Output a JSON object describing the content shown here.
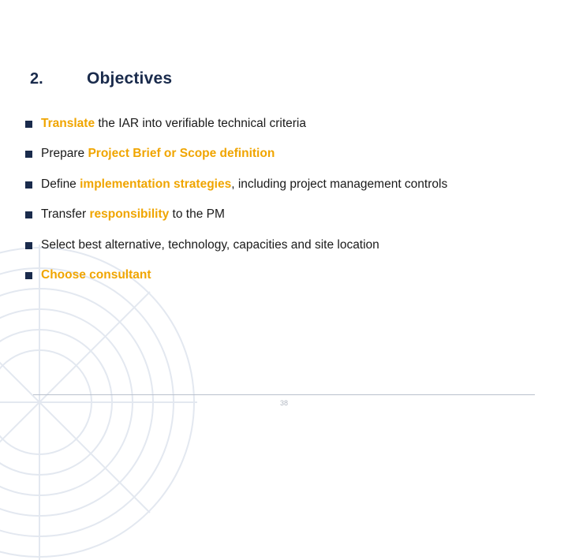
{
  "slide": {
    "title_number": "2.",
    "title": "Objectives",
    "page_number": "38",
    "accent_color": "#f0a500",
    "title_color": "#1a2b4c",
    "bullets": [
      {
        "id": "bullet-translate",
        "segments": [
          {
            "text": "Translate",
            "style": "accent"
          },
          {
            "text": " the IAR into verifiable technical criteria",
            "style": "plain"
          }
        ]
      },
      {
        "id": "bullet-prepare",
        "segments": [
          {
            "text": "Prepare ",
            "style": "plain"
          },
          {
            "text": "Project Brief or Scope definition",
            "style": "accent"
          }
        ]
      },
      {
        "id": "bullet-define",
        "justify": true,
        "segments": [
          {
            "text": "Define ",
            "style": "plain"
          },
          {
            "text": "implementation",
            "style": "accent"
          },
          {
            "text": " ",
            "style": "plain"
          },
          {
            "text": "strategies",
            "style": "accent"
          },
          {
            "text": ", including project management controls",
            "style": "plain"
          }
        ]
      },
      {
        "id": "bullet-transfer",
        "segments": [
          {
            "text": "Transfer ",
            "style": "plain"
          },
          {
            "text": "responsibility",
            "style": "accent"
          },
          {
            "text": " to the PM",
            "style": "plain"
          }
        ]
      },
      {
        "id": "bullet-select",
        "justify": true,
        "segments": [
          {
            "text": "Select best alternative, technology, capacities and site location",
            "style": "plain"
          }
        ]
      },
      {
        "id": "bullet-choose",
        "segments": [
          {
            "text": "Choose consultant",
            "style": "accent"
          }
        ]
      }
    ]
  }
}
